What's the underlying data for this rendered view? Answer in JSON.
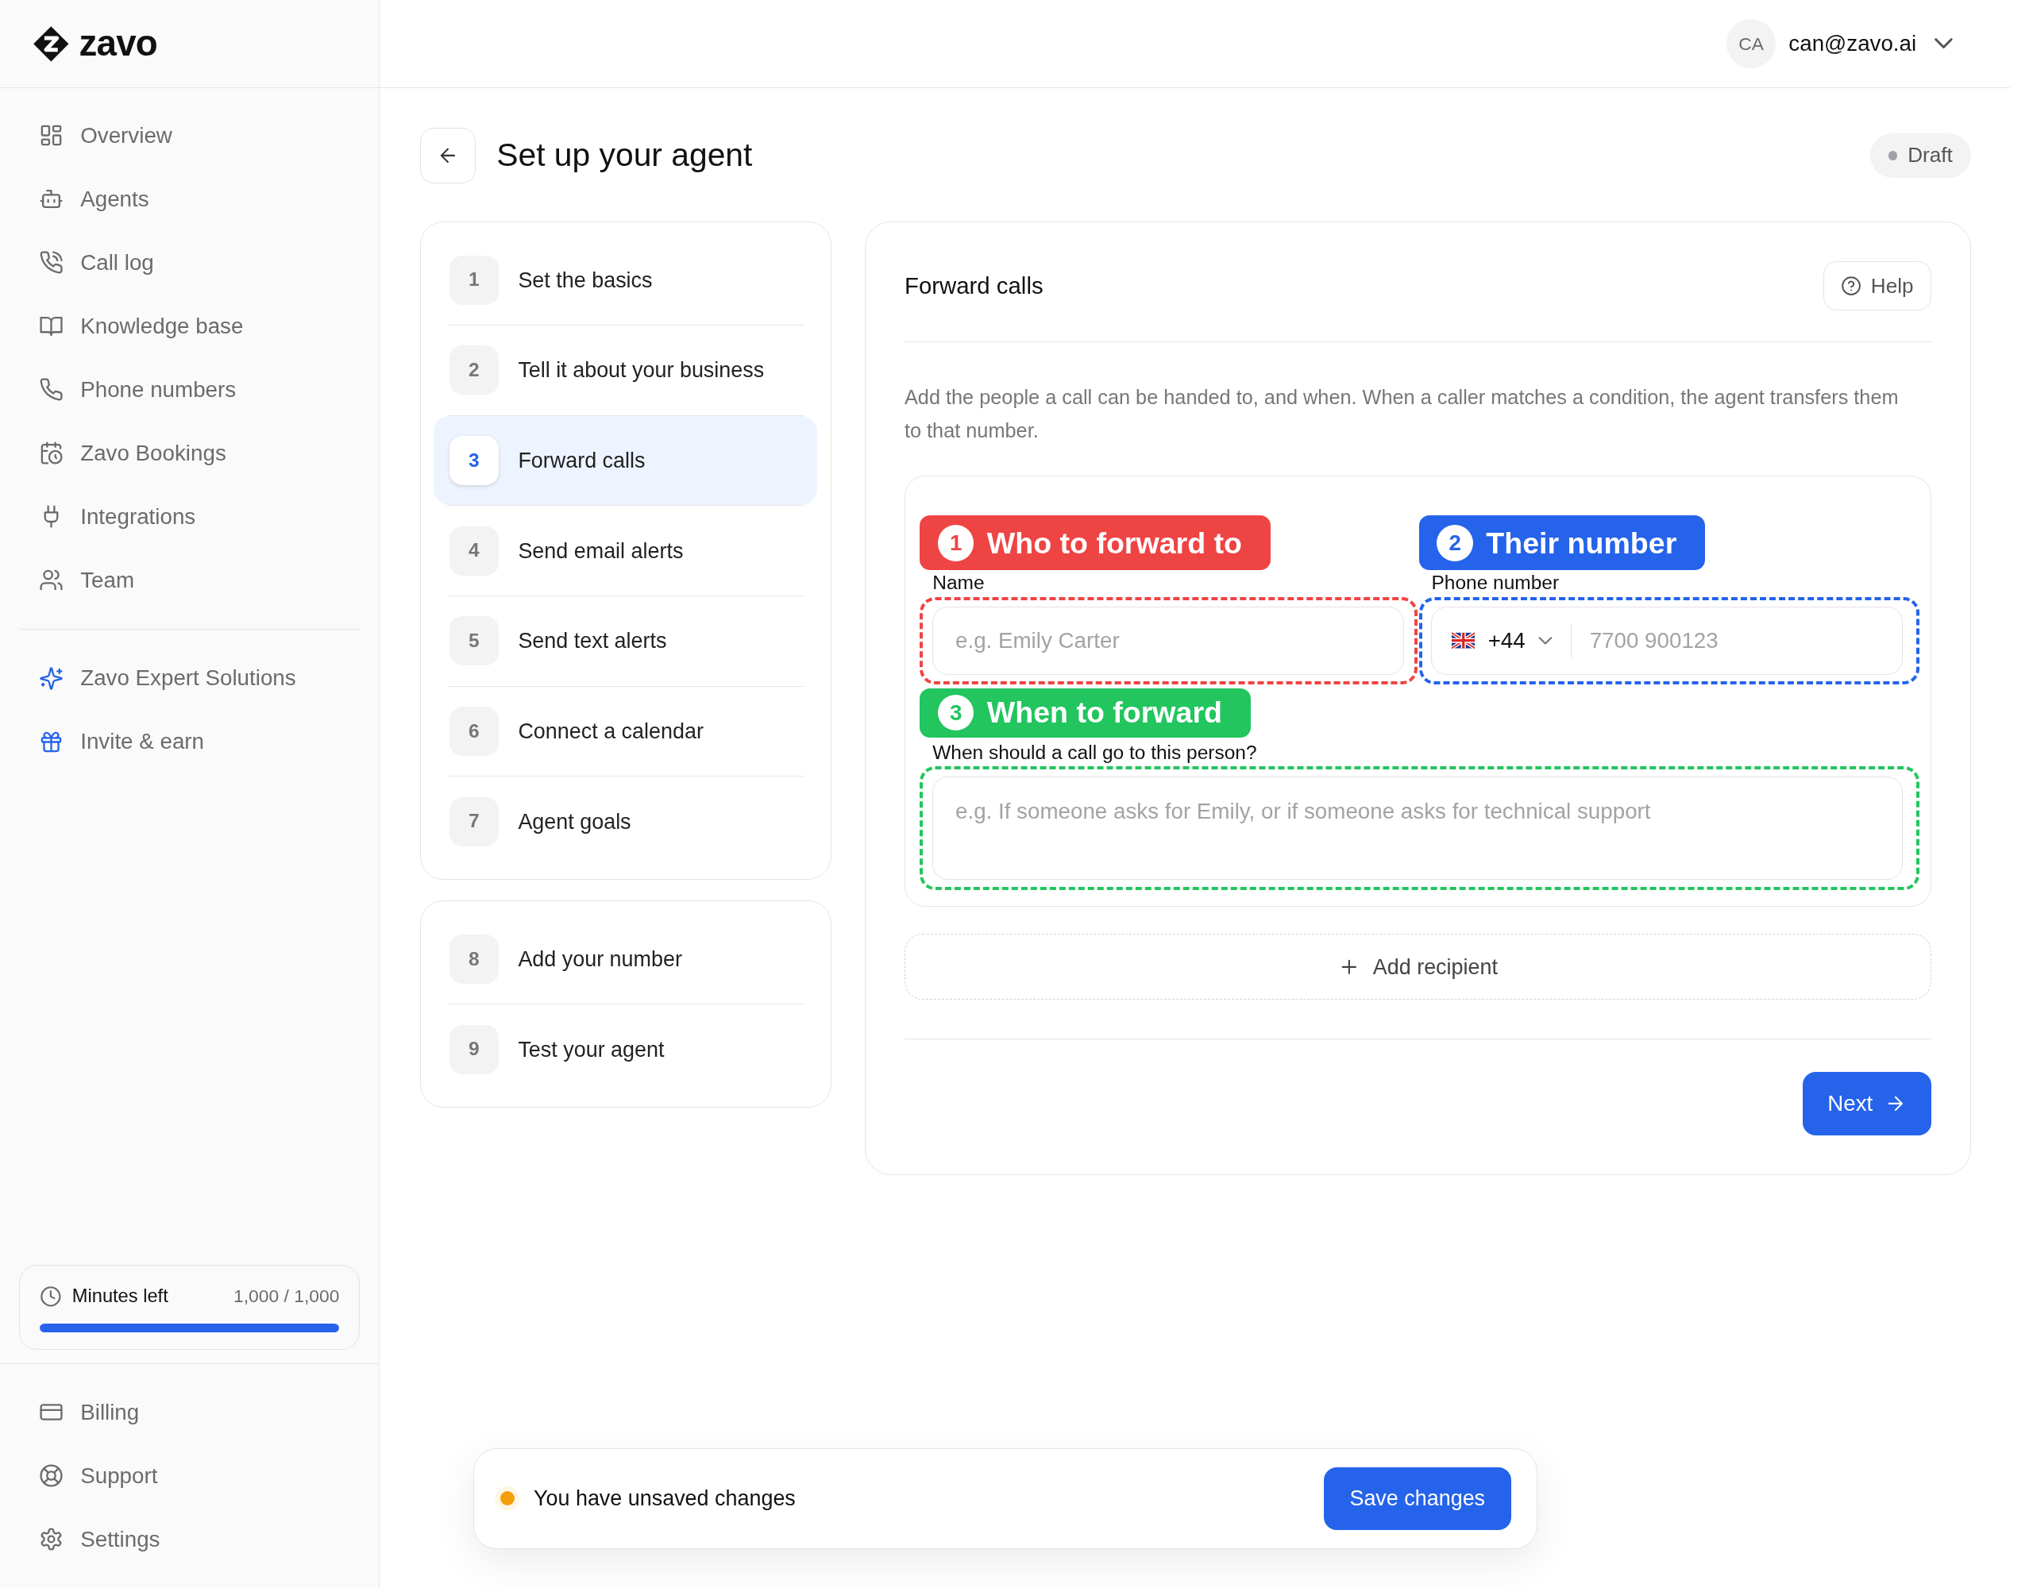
{
  "brand": {
    "name": "zavo"
  },
  "user": {
    "initials": "CA",
    "email": "can@zavo.ai"
  },
  "sidebar": {
    "main_items": [
      {
        "label": "Overview"
      },
      {
        "label": "Agents"
      },
      {
        "label": "Call log"
      },
      {
        "label": "Knowledge base"
      },
      {
        "label": "Phone numbers"
      },
      {
        "label": "Zavo Bookings"
      },
      {
        "label": "Integrations"
      },
      {
        "label": "Team"
      }
    ],
    "extra_items": [
      {
        "label": "Zavo Expert Solutions"
      },
      {
        "label": "Invite & earn"
      }
    ],
    "usage": {
      "label": "Minutes left",
      "reading": "1,000 / 1,000",
      "level": 1
    },
    "footer_items": [
      {
        "label": "Billing"
      },
      {
        "label": "Support"
      },
      {
        "label": "Settings"
      }
    ]
  },
  "page": {
    "title": "Set up your agent",
    "status": "Draft"
  },
  "step_groups": [
    {
      "steps": [
        {
          "number": "1",
          "label": "Set the basics",
          "selected": false
        },
        {
          "number": "2",
          "label": "Tell it about your business",
          "selected": false
        },
        {
          "number": "3",
          "label": "Forward calls",
          "selected": true
        },
        {
          "number": "4",
          "label": "Send email alerts",
          "selected": false
        },
        {
          "number": "5",
          "label": "Send text alerts",
          "selected": false
        },
        {
          "number": "6",
          "label": "Connect a calendar",
          "selected": false
        },
        {
          "number": "7",
          "label": "Agent goals",
          "selected": false
        }
      ]
    },
    {
      "steps": [
        {
          "number": "8",
          "label": "Add your number",
          "selected": false
        },
        {
          "number": "9",
          "label": "Test your agent",
          "selected": false
        }
      ]
    }
  ],
  "panel": {
    "title": "Forward calls",
    "help_button": "Help",
    "description": "Add the people a call can be handed to, and when. When a caller matches a condition, the agent transfers them to that number.",
    "recipient": {
      "name": {
        "label": "Name",
        "placeholder": "e.g. Emily Carter"
      },
      "phone": {
        "label": "Phone number",
        "country_code": "+44",
        "placeholder": "7700 900123"
      },
      "condition": {
        "label": "When should a call go to this person?",
        "placeholder": "e.g. If someone asks for Emily, or if someone asks for technical support"
      }
    },
    "add_button": "Add recipient",
    "next_button": "Next"
  },
  "annotations": [
    {
      "number": "1",
      "label": "Who to forward to",
      "color": "#ef4444"
    },
    {
      "number": "2",
      "label": "Their number",
      "color": "#2563eb"
    },
    {
      "number": "3",
      "label": "When to forward",
      "color": "#22c55e"
    }
  ],
  "unsaved_bar": {
    "message": "You have unsaved changes",
    "button": "Save changes"
  }
}
